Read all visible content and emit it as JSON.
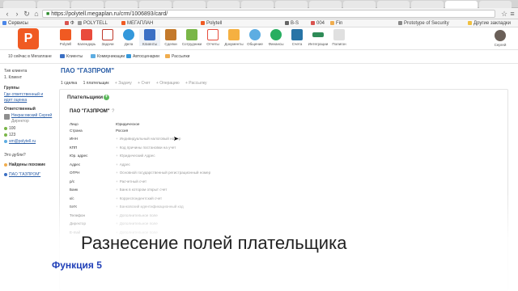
{
  "browser": {
    "url": "https://polytell.megaplan.ru/crm/1006893/card/",
    "bookmarks": [
      {
        "label": "Сервисы",
        "color": "#4a86e8"
      },
      {
        "label": "Ф",
        "color": "#d9534f"
      },
      {
        "label": "POLYTELL",
        "color": "#999999"
      },
      {
        "label": "МЕГАПЛАН",
        "color": "#f05a22"
      },
      {
        "label": "Polytell",
        "color": "#f05a22"
      },
      {
        "label": "B-S",
        "color": "#666666"
      },
      {
        "label": "004",
        "color": "#d9534f"
      },
      {
        "label": "Fin",
        "color": "#f0ad4e"
      },
      {
        "label": "Prototype of Security",
        "color": "#888888"
      },
      {
        "label": "Другие закладки",
        "color": "#f0c040"
      }
    ]
  },
  "app": {
    "logo": "P",
    "icons": [
      {
        "label": "Polytell",
        "color": "#f05a22"
      },
      {
        "label": "Календарь",
        "color": "#e94b3c"
      },
      {
        "label": "Задачи",
        "color": "#c0392b"
      },
      {
        "label": "Дела",
        "color": "#3498db"
      },
      {
        "label": "Клиенты",
        "color": "#3b6fc4"
      },
      {
        "label": "Сделки",
        "color": "#c47a2c"
      },
      {
        "label": "Сотрудники",
        "color": "#7ab648"
      },
      {
        "label": "Отчеты",
        "color": "#e74c3c"
      },
      {
        "label": "Документы",
        "color": "#f5b041"
      },
      {
        "label": "Общение",
        "color": "#5dade2"
      },
      {
        "label": "Финансы",
        "color": "#27ae60"
      },
      {
        "label": "Счета",
        "color": "#2874a6"
      },
      {
        "label": "Интеграции",
        "color": "#2e8b57"
      },
      {
        "label": "Полигон",
        "color": "#e0e0e0"
      }
    ],
    "user_label": "Сергей"
  },
  "subheader": {
    "left": "10 сейчас в Мегаплане",
    "items": [
      {
        "label": "Клиенты",
        "color": "#3b6fc4"
      },
      {
        "label": "Коммуникации",
        "color": "#5dade2"
      },
      {
        "label": "Автосценарии",
        "color": "#3498db"
      },
      {
        "label": "Рассылки",
        "color": "#f0ad4e"
      }
    ]
  },
  "sidebar": {
    "client_type_label": "Тип клиента",
    "client_type_value": "1. Клиент",
    "groups_label": "Группы",
    "groups_links": [
      "Где ответственный и",
      "идет оценка"
    ],
    "responsible_label": "Ответственный",
    "responsible_name": "Некрасовский Сергей",
    "responsible_role": "Директор",
    "phone1": "100",
    "phone2": "123",
    "email": "sm@polytell.ru",
    "dubble_label": "Это дубли?",
    "found_similar": "Найдены похожие",
    "similar_link": "ПАО \"ГАЗПРОМ\""
  },
  "main": {
    "title": "ПАО \"ГАЗПРОМ\"",
    "steps": [
      "1 сделка",
      "1 плательщик",
      "Задачу",
      "Счет",
      "Операцию",
      "Рассылку"
    ],
    "payers_title": "Плательщики",
    "company": "ПАО \"ГАЗПРОМ\"",
    "question": "?",
    "fields": [
      {
        "label": "Лицо",
        "value": "Юридическое",
        "placeholder": false
      },
      {
        "label": "Страна",
        "value": "Россия",
        "placeholder": false
      },
      {
        "label": "ИНН",
        "value": "Индивидуальный налоговый номер",
        "placeholder": true
      },
      {
        "label": "КПП",
        "value": "Код причины постановки на учет",
        "placeholder": true
      },
      {
        "label": "Юр. адрес",
        "value": "Юридический Адрес",
        "placeholder": true
      },
      {
        "label": "Адрес",
        "value": "Адрес",
        "placeholder": true
      },
      {
        "label": "ОГРН",
        "value": "Основной государственный регистрационный номер",
        "placeholder": true
      },
      {
        "label": "р/с",
        "value": "Расчетный счет",
        "placeholder": true
      },
      {
        "label": "Банк",
        "value": "Банк в котором открыт счет",
        "placeholder": true
      },
      {
        "label": "к/с",
        "value": "Корреспондентский счет",
        "placeholder": true
      },
      {
        "label": "БИК",
        "value": "Банковский идентификационный код",
        "placeholder": true
      },
      {
        "label": "Телефон",
        "value": "Дополнительное поле",
        "placeholder": true
      },
      {
        "label": "Директор",
        "value": "Дополнительное поле",
        "placeholder": true
      },
      {
        "label": "E-mail",
        "value": "Дополнительное поле",
        "placeholder": true
      }
    ]
  },
  "overlay": {
    "caption": "Разнесение полей плательщика",
    "function_label": "Функция 5"
  }
}
